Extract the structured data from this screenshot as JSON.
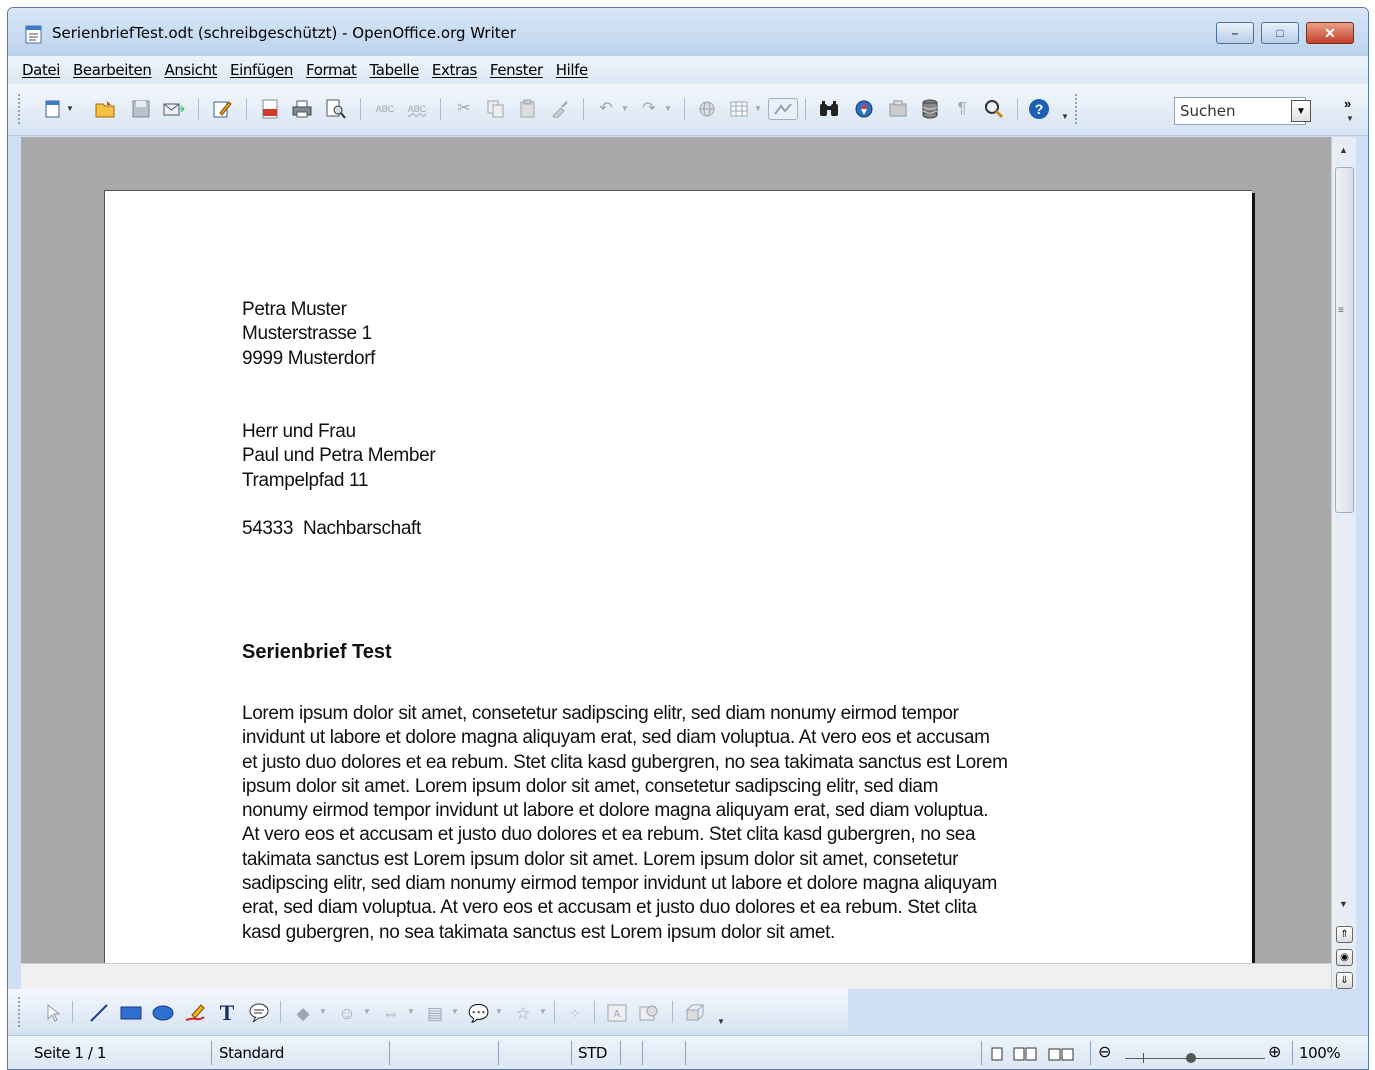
{
  "window": {
    "title": "SerienbriefTest.odt (schreibgeschützt) - OpenOffice.org Writer",
    "min_glyph": "–",
    "max_glyph": "□",
    "close_glyph": "✕"
  },
  "menu": {
    "items": [
      "Datei",
      "Bearbeiten",
      "Ansicht",
      "Einfügen",
      "Format",
      "Tabelle",
      "Extras",
      "Fenster",
      "Hilfe"
    ]
  },
  "toolbar": {
    "search_value": "Suchen",
    "overflow": "»",
    "dropdown_arrow": "▼"
  },
  "document": {
    "sender": [
      "Petra Muster",
      "Musterstrasse 1",
      "9999 Musterdorf"
    ],
    "recipient": [
      "Herr und Frau",
      "Paul und Petra Member",
      "Trampelpfad 11",
      "",
      "54333  Nachbarschaft"
    ],
    "heading": "Serienbrief Test",
    "body": "Lorem ipsum dolor sit amet, consetetur sadipscing elitr, sed diam nonumy eirmod tempor\ninvidunt ut labore et dolore magna aliquyam erat, sed diam voluptua. At vero eos et accusam\net justo duo dolores et ea rebum. Stet clita kasd gubergren, no sea takimata sanctus est Lorem\nipsum dolor sit amet. Lorem ipsum dolor sit amet, consetetur sadipscing elitr, sed diam\nnonumy eirmod tempor invidunt ut labore et dolore magna aliquyam erat, sed diam voluptua.\nAt vero eos et accusam et justo duo dolores et ea rebum. Stet clita kasd gubergren, no sea\ntakimata sanctus est Lorem ipsum dolor sit amet. Lorem ipsum dolor sit amet, consetetur\nsadipscing elitr, sed diam nonumy eirmod tempor invidunt ut labore et dolore magna aliquyam\nerat, sed diam voluptua. At vero eos et accusam et justo duo dolores et ea rebum. Stet clita\nkasd gubergren, no sea takimata sanctus est Lorem ipsum dolor sit amet."
  },
  "scrollbar": {
    "up": "▲",
    "down": "▼",
    "grip": "≡",
    "prev_page": "⇑",
    "navigator": "◉",
    "next_page": "⇓"
  },
  "statusbar": {
    "page": "Seite 1 / 1",
    "style": "Standard",
    "mode": "STD",
    "zoom_minus": "⊖",
    "zoom_plus": "⊕",
    "zoom": "100%"
  },
  "colors": {
    "window_frame": "#cfe0f2",
    "document_background": "#a9a9a9",
    "page": "#ffffff"
  }
}
